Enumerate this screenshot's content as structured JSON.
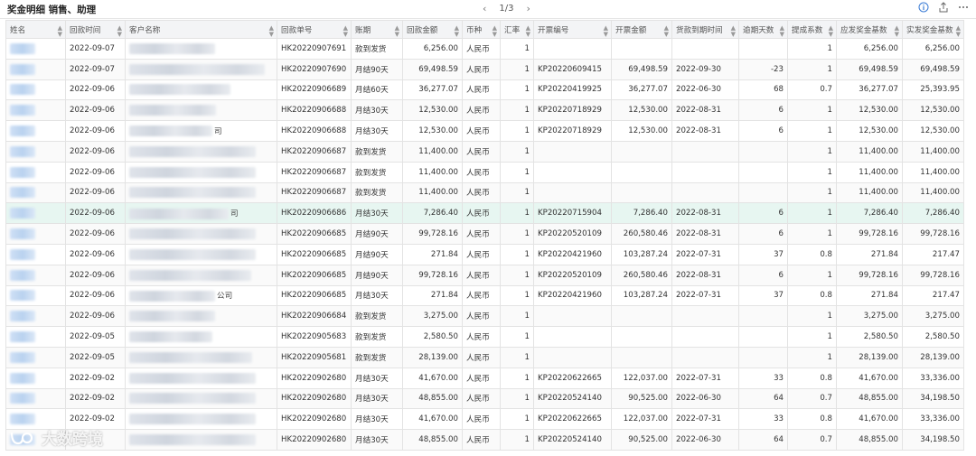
{
  "header": {
    "title": "奖金明细 销售、助理",
    "page_indicator": "1/3",
    "prev": "‹",
    "next": "›"
  },
  "columns": [
    "姓名",
    "回款时间",
    "客户名称",
    "回款单号",
    "账期",
    "回款金额",
    "币种",
    "汇率",
    "开票编号",
    "开票金额",
    "货款到期时间",
    "逾期天数",
    "提成系数",
    "应发奖金基数",
    "实发奖金基数"
  ],
  "rows": [
    {
      "date": "2022-09-07",
      "cust_tail": "",
      "order": "HK20220907691",
      "term": "款到发货",
      "amount": "6,256.00",
      "currency": "人民币",
      "rate": "1",
      "inv_no": "",
      "inv_amt": "",
      "due": "",
      "overdue": "",
      "coef": "1",
      "base": "6,256.00",
      "actual": "6,256.00"
    },
    {
      "date": "2022-09-07",
      "cust_tail": "",
      "order": "HK20220907690",
      "term": "月结90天",
      "amount": "69,498.59",
      "currency": "人民币",
      "rate": "1",
      "inv_no": "KP20220609415",
      "inv_amt": "69,498.59",
      "due": "2022-09-30",
      "overdue": "-23",
      "coef": "1",
      "base": "69,498.59",
      "actual": "69,498.59"
    },
    {
      "date": "2022-09-06",
      "cust_tail": "",
      "order": "HK20220906689",
      "term": "月结60天",
      "amount": "36,277.07",
      "currency": "人民币",
      "rate": "1",
      "inv_no": "KP20220419925",
      "inv_amt": "36,277.07",
      "due": "2022-06-30",
      "overdue": "68",
      "coef": "0.7",
      "base": "36,277.07",
      "actual": "25,393.95"
    },
    {
      "date": "2022-09-06",
      "cust_tail": "",
      "order": "HK20220906688",
      "term": "月结30天",
      "amount": "12,530.00",
      "currency": "人民币",
      "rate": "1",
      "inv_no": "KP20220718929",
      "inv_amt": "12,530.00",
      "due": "2022-08-31",
      "overdue": "6",
      "coef": "1",
      "base": "12,530.00",
      "actual": "12,530.00"
    },
    {
      "date": "2022-09-06",
      "cust_tail": "司",
      "order": "HK20220906688",
      "term": "月结30天",
      "amount": "12,530.00",
      "currency": "人民币",
      "rate": "1",
      "inv_no": "KP20220718929",
      "inv_amt": "12,530.00",
      "due": "2022-08-31",
      "overdue": "6",
      "coef": "1",
      "base": "12,530.00",
      "actual": "12,530.00"
    },
    {
      "date": "2022-09-06",
      "cust_tail": "",
      "order": "HK20220906687",
      "term": "款到发货",
      "amount": "11,400.00",
      "currency": "人民币",
      "rate": "1",
      "inv_no": "",
      "inv_amt": "",
      "due": "",
      "overdue": "",
      "coef": "1",
      "base": "11,400.00",
      "actual": "11,400.00"
    },
    {
      "date": "2022-09-06",
      "cust_tail": "",
      "order": "HK20220906687",
      "term": "款到发货",
      "amount": "11,400.00",
      "currency": "人民币",
      "rate": "1",
      "inv_no": "",
      "inv_amt": "",
      "due": "",
      "overdue": "",
      "coef": "1",
      "base": "11,400.00",
      "actual": "11,400.00"
    },
    {
      "date": "2022-09-06",
      "cust_tail": "",
      "order": "HK20220906687",
      "term": "款到发货",
      "amount": "11,400.00",
      "currency": "人民币",
      "rate": "1",
      "inv_no": "",
      "inv_amt": "",
      "due": "",
      "overdue": "",
      "coef": "1",
      "base": "11,400.00",
      "actual": "11,400.00"
    },
    {
      "date": "2022-09-06",
      "cust_tail": "司",
      "order": "HK20220906686",
      "term": "月结30天",
      "amount": "7,286.40",
      "currency": "人民币",
      "rate": "1",
      "inv_no": "KP20220715904",
      "inv_amt": "7,286.40",
      "due": "2022-08-31",
      "overdue": "6",
      "coef": "1",
      "base": "7,286.40",
      "actual": "7,286.40"
    },
    {
      "date": "2022-09-06",
      "cust_tail": "",
      "order": "HK20220906685",
      "term": "月结90天",
      "amount": "99,728.16",
      "currency": "人民币",
      "rate": "1",
      "inv_no": "KP20220520109",
      "inv_amt": "260,580.46",
      "due": "2022-08-31",
      "overdue": "6",
      "coef": "1",
      "base": "99,728.16",
      "actual": "99,728.16"
    },
    {
      "date": "2022-09-06",
      "cust_tail": "",
      "order": "HK20220906685",
      "term": "月结90天",
      "amount": "271.84",
      "currency": "人民币",
      "rate": "1",
      "inv_no": "KP20220421960",
      "inv_amt": "103,287.24",
      "due": "2022-07-31",
      "overdue": "37",
      "coef": "0.8",
      "base": "271.84",
      "actual": "217.47"
    },
    {
      "date": "2022-09-06",
      "cust_tail": "",
      "order": "HK20220906685",
      "term": "月结90天",
      "amount": "99,728.16",
      "currency": "人民币",
      "rate": "1",
      "inv_no": "KP20220520109",
      "inv_amt": "260,580.46",
      "due": "2022-08-31",
      "overdue": "6",
      "coef": "1",
      "base": "99,728.16",
      "actual": "99,728.16"
    },
    {
      "date": "2022-09-06",
      "cust_tail": "公司",
      "order": "HK20220906685",
      "term": "月结30天",
      "amount": "271.84",
      "currency": "人民币",
      "rate": "1",
      "inv_no": "KP20220421960",
      "inv_amt": "103,287.24",
      "due": "2022-07-31",
      "overdue": "37",
      "coef": "0.8",
      "base": "271.84",
      "actual": "217.47"
    },
    {
      "date": "2022-09-06",
      "cust_tail": "",
      "order": "HK20220906684",
      "term": "款到发货",
      "amount": "3,275.00",
      "currency": "人民币",
      "rate": "1",
      "inv_no": "",
      "inv_amt": "",
      "due": "",
      "overdue": "",
      "coef": "1",
      "base": "3,275.00",
      "actual": "3,275.00"
    },
    {
      "date": "2022-09-05",
      "cust_tail": "",
      "order": "HK20220905683",
      "term": "款到发货",
      "amount": "2,580.50",
      "currency": "人民币",
      "rate": "1",
      "inv_no": "",
      "inv_amt": "",
      "due": "",
      "overdue": "",
      "coef": "1",
      "base": "2,580.50",
      "actual": "2,580.50"
    },
    {
      "date": "2022-09-05",
      "cust_tail": "",
      "order": "HK20220905681",
      "term": "款到发货",
      "amount": "28,139.00",
      "currency": "人民币",
      "rate": "1",
      "inv_no": "",
      "inv_amt": "",
      "due": "",
      "overdue": "",
      "coef": "1",
      "base": "28,139.00",
      "actual": "28,139.00"
    },
    {
      "date": "2022-09-02",
      "cust_tail": "",
      "order": "HK20220902680",
      "term": "月结30天",
      "amount": "41,670.00",
      "currency": "人民币",
      "rate": "1",
      "inv_no": "KP20220622665",
      "inv_amt": "122,037.00",
      "due": "2022-07-31",
      "overdue": "33",
      "coef": "0.8",
      "base": "41,670.00",
      "actual": "33,336.00"
    },
    {
      "date": "2022-09-02",
      "cust_tail": "",
      "order": "HK20220902680",
      "term": "月结30天",
      "amount": "48,855.00",
      "currency": "人民币",
      "rate": "1",
      "inv_no": "KP20220524140",
      "inv_amt": "90,525.00",
      "due": "2022-06-30",
      "overdue": "64",
      "coef": "0.7",
      "base": "48,855.00",
      "actual": "34,198.50"
    },
    {
      "date": "2022-09-02",
      "cust_tail": "",
      "order": "HK20220902680",
      "term": "月结30天",
      "amount": "41,670.00",
      "currency": "人民币",
      "rate": "1",
      "inv_no": "KP20220622665",
      "inv_amt": "122,037.00",
      "due": "2022-07-31",
      "overdue": "33",
      "coef": "0.8",
      "base": "41,670.00",
      "actual": "33,336.00"
    },
    {
      "date": "",
      "cust_tail": "",
      "order": "HK20220902680",
      "term": "月结30天",
      "amount": "48,855.00",
      "currency": "人民币",
      "rate": "1",
      "inv_no": "KP20220524140",
      "inv_amt": "90,525.00",
      "due": "2022-06-30",
      "overdue": "64",
      "coef": "0.7",
      "base": "48,855.00",
      "actual": "34,198.50"
    }
  ],
  "highlight_row": 8,
  "watermark": {
    "text": "大数跨境"
  },
  "icons": [
    "info-icon",
    "export-icon",
    "more-icon"
  ],
  "colors": {
    "highlight": "#e7f6f1",
    "header_bg": "#f3f4f6"
  }
}
